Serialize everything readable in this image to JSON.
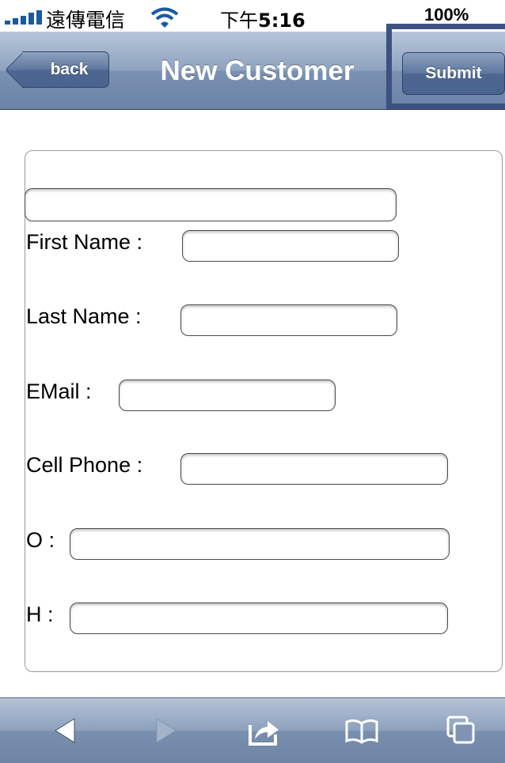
{
  "status_bar": {
    "carrier": "遠傳電信",
    "time_prefix": "下午",
    "time": "5:16",
    "battery": "100%"
  },
  "nav": {
    "back_label": "back",
    "title": "New Customer",
    "submit_label": "Submit"
  },
  "form": {
    "fields": [
      {
        "label": "First Name :",
        "value": ""
      },
      {
        "label": "Last Name :",
        "value": ""
      },
      {
        "label": "EMail :",
        "value": ""
      },
      {
        "label": "Cell Phone :",
        "value": ""
      },
      {
        "label": "O :",
        "value": ""
      },
      {
        "label": "H :",
        "value": ""
      }
    ]
  },
  "toolbar": {
    "icons": [
      "back-arrow-icon",
      "forward-arrow-icon",
      "share-icon",
      "bookmarks-icon",
      "tabs-icon"
    ]
  },
  "colors": {
    "nav_bar": "#7a91b2",
    "button": "#4d6790",
    "highlight_box": "#3d5182"
  }
}
